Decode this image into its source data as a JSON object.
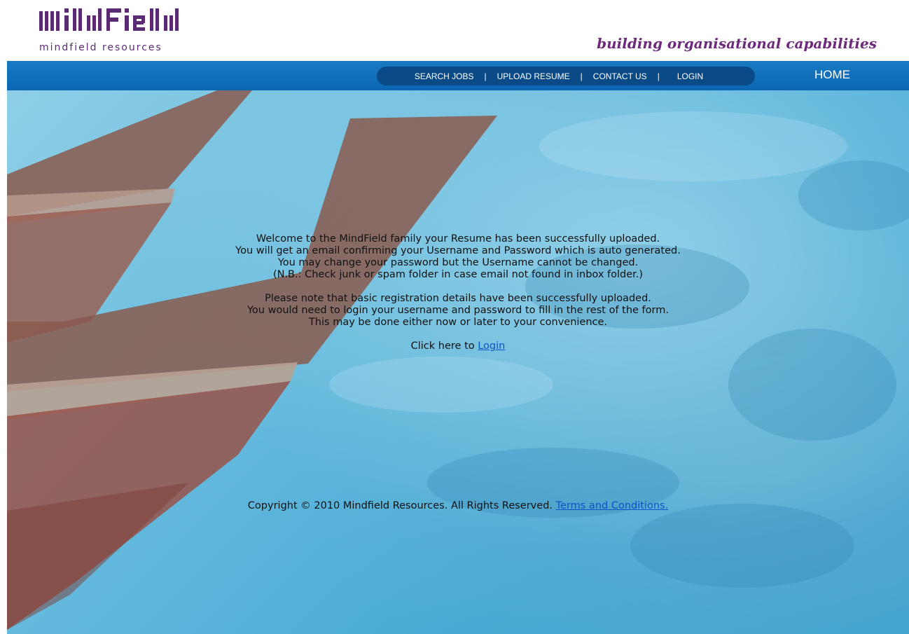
{
  "header": {
    "logo_text": "MINDFIELD",
    "logo_subtitle": "mindfield resources",
    "tagline": "building organisational capabilities",
    "brand_color": "#5a2a73"
  },
  "nav": {
    "items": [
      {
        "label": "SEARCH JOBS"
      },
      {
        "label": "UPLOAD RESUME"
      },
      {
        "label": "CONTACT US"
      },
      {
        "label": "LOGIN"
      }
    ],
    "separator": "|",
    "home_label": "HOME",
    "bar_color": "#0b66b2"
  },
  "main": {
    "paragraph1": [
      "Welcome to the MindField family your Resume has been successfully uploaded.",
      "You will get an email confirming your Username and Password which is auto generated.",
      "You may change your password but the Username cannot be changed.",
      "(N.B.: Check junk or spam folder in case email not found in inbox folder.)"
    ],
    "paragraph2": [
      "Please note that basic registration details have been successfully uploaded.",
      "You would need to login your username and password to fill in the rest of the form.",
      "This may be done either now or later to your convenience."
    ],
    "click_prefix": "Click here to ",
    "login_link": "Login"
  },
  "footer": {
    "copyright": "Copyright © 2010 Mindfield Resources. All Rights Reserved. ",
    "terms_link": "Terms and Conditions."
  }
}
